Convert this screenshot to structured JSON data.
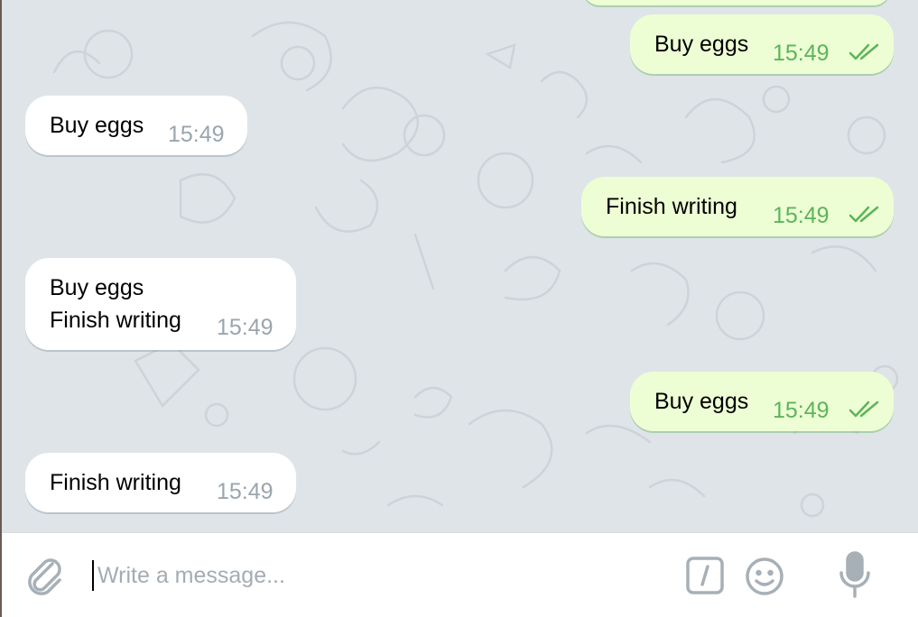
{
  "composer": {
    "placeholder": "Write a message...",
    "attach_icon": "paperclip-icon",
    "command_icon": "slash-command-icon",
    "emoji_icon": "smiley-icon",
    "mic_icon": "microphone-icon"
  },
  "messages": [
    {
      "direction": "outgoing",
      "text": "Buy eggs",
      "time": "15:49",
      "status": "read"
    },
    {
      "direction": "incoming",
      "text": "Buy eggs",
      "time": "15:49"
    },
    {
      "direction": "outgoing",
      "text": "Finish writing",
      "time": "15:49",
      "status": "read"
    },
    {
      "direction": "incoming",
      "text": "Buy eggs\nFinish writing",
      "time": "15:49"
    },
    {
      "direction": "outgoing",
      "text": "Buy eggs",
      "time": "15:49",
      "status": "read"
    },
    {
      "direction": "incoming",
      "text": "Finish writing",
      "time": "15:49"
    }
  ],
  "colors": {
    "chat_background": "#dfe4e8",
    "incoming_bubble": "#ffffff",
    "outgoing_bubble": "#eefed4",
    "outgoing_time": "#5cb45a",
    "incoming_time": "#9aa5ad",
    "icon_gray": "#a7b0b7"
  }
}
